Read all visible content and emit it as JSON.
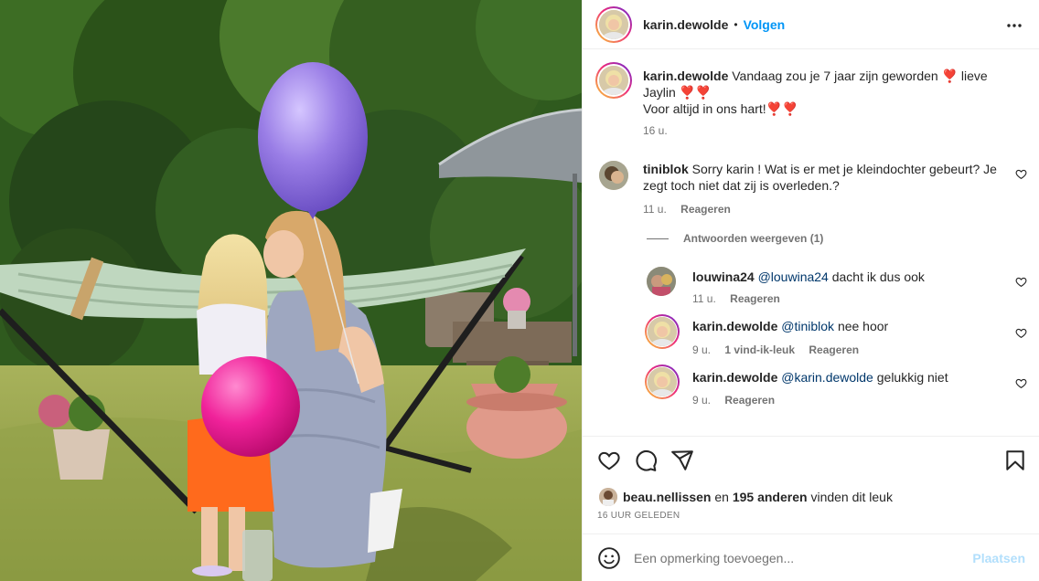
{
  "post": {
    "author": "karin.dewolde",
    "follow_label": "Volgen",
    "header_separator": "•"
  },
  "caption": {
    "username": "karin.dewolde",
    "line1": "Vandaag zou je 7 jaar zijn geworden",
    "line1_tail": "lieve Jaylin",
    "line2": "Voor altijd in ons hart!",
    "heart_glyph": "❣️",
    "time": "16 u."
  },
  "comments": [
    {
      "username": "tiniblok",
      "text": "Sorry karin ! Wat is er met je kleindochter gebeurt? Je zegt toch niet dat zij is overleden.?",
      "time": "11 u.",
      "reply_label": "Reageren",
      "show_replies_label": "Antwoorden weergeven (1)"
    }
  ],
  "replies": [
    {
      "username": "louwina24",
      "mention": "@louwina24",
      "text": "dacht ik dus ook",
      "time": "11 u.",
      "reply_label": "Reageren"
    },
    {
      "username": "karin.dewolde",
      "mention": "@tiniblok",
      "text": "nee hoor",
      "time": "9 u.",
      "likes_label": "1 vind-ik-leuk",
      "reply_label": "Reageren"
    },
    {
      "username": "karin.dewolde",
      "mention": "@karin.dewolde",
      "text": "gelukkig niet",
      "time": "9 u.",
      "reply_label": "Reageren"
    }
  ],
  "likes": {
    "first_liker": "beau.nellissen",
    "connector": "en",
    "others": "195 anderen",
    "suffix": "vinden dit leuk"
  },
  "timestamp": "16 UUR GELEDEN",
  "add_comment": {
    "placeholder": "Een opmerking toevoegen...",
    "post_label": "Plaatsen"
  },
  "colors": {
    "accent": "#0095f6",
    "post_disabled": "#b2dffc",
    "mention": "#00376b",
    "heart_red": "#e0102f"
  },
  "icons": [
    "more-options-icon",
    "heart-icon",
    "comment-icon",
    "share-icon",
    "bookmark-icon",
    "emoji-icon",
    "heart-small-icon"
  ]
}
